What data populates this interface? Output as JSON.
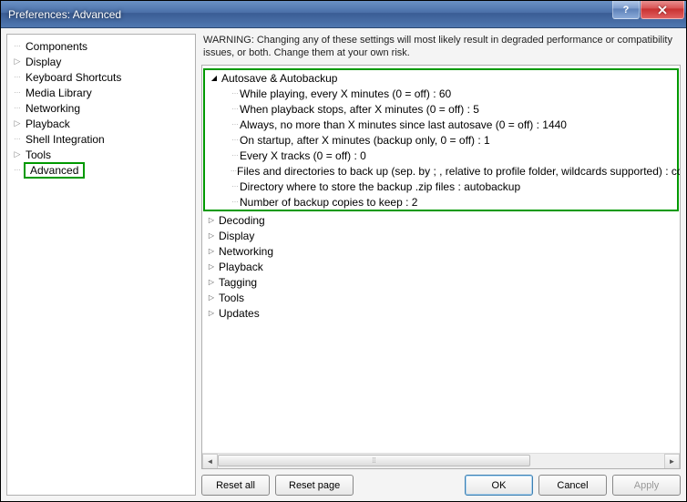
{
  "window": {
    "title": "Preferences: Advanced",
    "help": "?"
  },
  "sidebar": {
    "items": [
      {
        "label": "Components",
        "expandable": false
      },
      {
        "label": "Display",
        "expandable": true
      },
      {
        "label": "Keyboard Shortcuts",
        "expandable": false
      },
      {
        "label": "Media Library",
        "expandable": false
      },
      {
        "label": "Networking",
        "expandable": false
      },
      {
        "label": "Playback",
        "expandable": true
      },
      {
        "label": "Shell Integration",
        "expandable": false
      },
      {
        "label": "Tools",
        "expandable": true
      },
      {
        "label": "Advanced",
        "expandable": false,
        "selected": true
      }
    ]
  },
  "warning": "WARNING: Changing any of these settings will most likely result in degraded performance or compatibility issues, or both. Change them at your own risk.",
  "settings": {
    "groups": [
      {
        "label": "Autosave & Autobackup",
        "open": true,
        "highlighted": true,
        "items": [
          "While playing, every X minutes (0 = off) : 60",
          "When playback stops, after X minutes (0 = off) : 5",
          "Always, no more than X minutes since last autosave (0 = off) : 1440",
          "On startup, after X minutes (backup only, 0 = off) : 1",
          "Every X tracks (0 = off) : 0",
          "Files and directories to back up (sep. by ; , relative to profile folder, wildcards supported) : con",
          "Directory where to store the backup .zip files : autobackup",
          "Number of backup copies to keep : 2"
        ]
      },
      {
        "label": "Decoding",
        "open": false
      },
      {
        "label": "Display",
        "open": false
      },
      {
        "label": "Networking",
        "open": false
      },
      {
        "label": "Playback",
        "open": false
      },
      {
        "label": "Tagging",
        "open": false
      },
      {
        "label": "Tools",
        "open": false
      },
      {
        "label": "Updates",
        "open": false
      }
    ]
  },
  "buttons": {
    "reset_all": "Reset all",
    "reset_page": "Reset page",
    "ok": "OK",
    "cancel": "Cancel",
    "apply": "Apply"
  }
}
